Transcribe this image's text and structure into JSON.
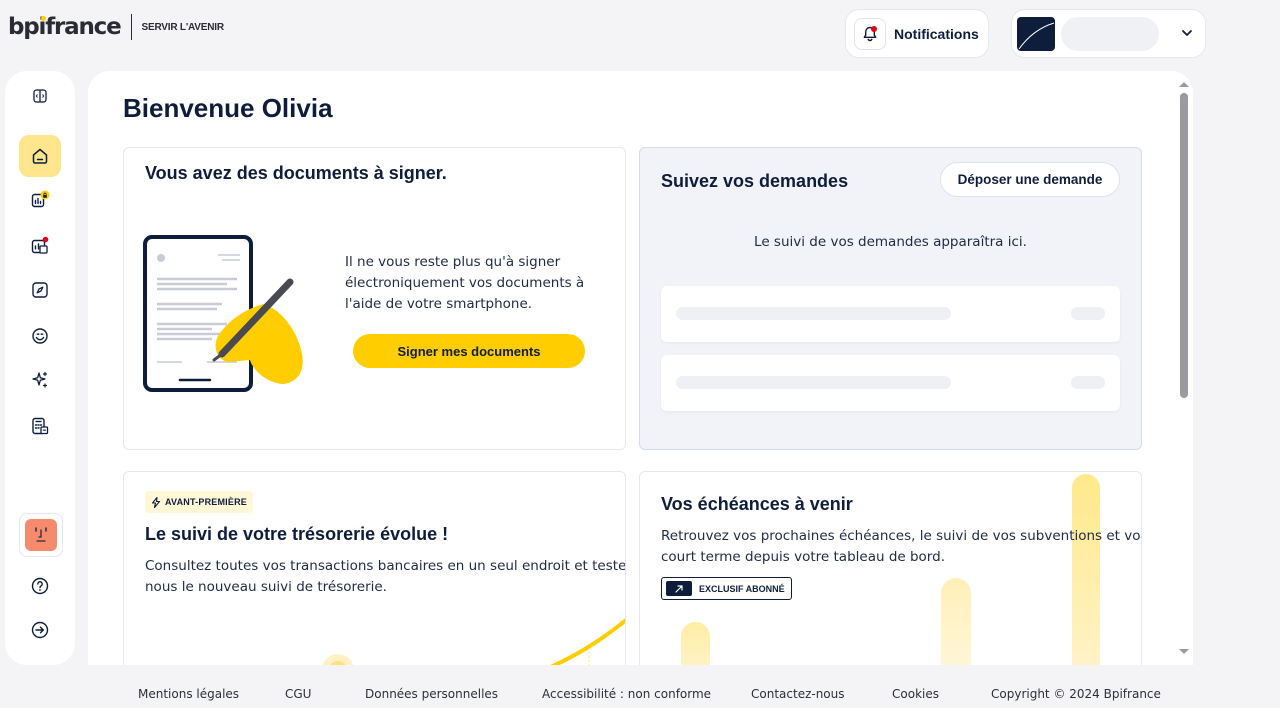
{
  "brand": {
    "name_part1": "bp",
    "name_i": "i",
    "name_part2": "france",
    "tagline": "SERVIR L'AVENIR"
  },
  "header": {
    "notifications_label": "Notifications"
  },
  "sidebar": {
    "items": [
      {
        "name": "collapse",
        "icon": "sidebar-toggle-icon"
      },
      {
        "name": "home",
        "icon": "home-icon",
        "active": true
      },
      {
        "name": "finances",
        "icon": "chart-lock-icon"
      },
      {
        "name": "dashboard",
        "icon": "chart-alert-icon"
      },
      {
        "name": "explore",
        "icon": "compass-icon"
      },
      {
        "name": "support",
        "icon": "smile-icon"
      },
      {
        "name": "ai",
        "icon": "sparkles-icon"
      },
      {
        "name": "simulators",
        "icon": "calculator-icon"
      }
    ]
  },
  "main": {
    "title": "Bienvenue Olivia",
    "sign_card": {
      "title": "Vous avez des documents à signer.",
      "text_line1": "Il ne vous reste plus qu'à signer",
      "text_line2": "électroniquement vos documents à",
      "text_line3": "l'aide de votre smartphone.",
      "button": "Signer mes documents"
    },
    "track_card": {
      "title": "Suivez vos demandes",
      "button": "Déposer une demande",
      "empty_text": "Le suivi de vos demandes apparaîtra ici."
    },
    "treasury_card": {
      "tag": "AVANT-PREMIÈRE",
      "title": "Le suivi de votre trésorerie évolue !",
      "text_line1": "Consultez toutes vos transactions bancaires en un seul endroit et testez avec",
      "text_line2": "nous le nouveau suivi de trésorerie."
    },
    "deadlines_card": {
      "title": "Vos échéances à venir",
      "text_line1": "Retrouvez vos prochaines échéances, le suivi de vos subventions et vos lignes",
      "text_line2": "court terme depuis votre tableau de bord.",
      "tag": "EXCLUSIF ABONNÉ"
    }
  },
  "footer": {
    "links": [
      "Mentions légales",
      "CGU",
      "Données personnelles",
      "Accessibilité : non conforme",
      "Contactez-nous",
      "Cookies",
      "Copyright © 2024 Bpifrance"
    ]
  },
  "colors": {
    "brand_yellow": "#ffcd00",
    "navy": "#0f1d3d",
    "avatar_orange": "#f58a6c"
  }
}
